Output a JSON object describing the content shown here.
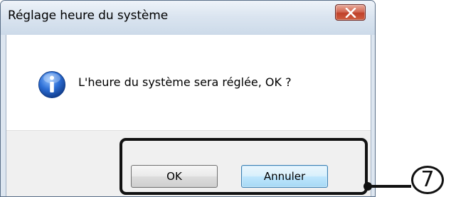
{
  "window": {
    "title": "Réglage heure du système",
    "close_icon": "close-icon"
  },
  "message": {
    "icon": "info-icon",
    "text": "L'heure du système sera réglée, OK ?"
  },
  "buttons": {
    "ok_label": "OK",
    "cancel_label": "Annuler"
  },
  "annotation": {
    "step_number": "7"
  },
  "colors": {
    "close_button": "#c0412a",
    "info_icon": "#2d6fd6",
    "default_button_border": "#3c7fb1"
  }
}
